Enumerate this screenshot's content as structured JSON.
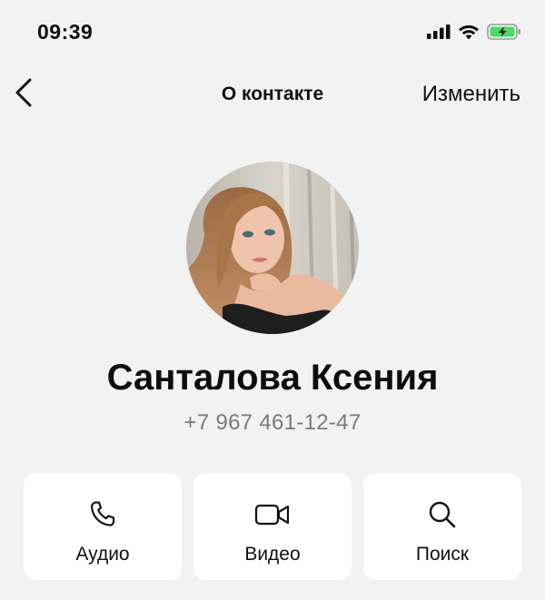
{
  "status_bar": {
    "time": "09:39",
    "icons": [
      "cellular-signal-icon",
      "wifi-icon",
      "battery-charging-icon"
    ]
  },
  "nav": {
    "back_icon": "chevron-left-icon",
    "title": "О контакте",
    "edit_label": "Изменить"
  },
  "contact": {
    "name": "Санталова Ксения",
    "phone": "+7 967 461-12-47"
  },
  "actions": [
    {
      "label": "Аудио",
      "icon": "phone-icon"
    },
    {
      "label": "Видео",
      "icon": "video-camera-icon"
    },
    {
      "label": "Поиск",
      "icon": "search-icon"
    }
  ],
  "colors": {
    "background": "#f2f2f2",
    "card": "#ffffff",
    "text": "#111111",
    "secondary_text": "#7a7a7a",
    "battery_charge": "#4cd964"
  }
}
